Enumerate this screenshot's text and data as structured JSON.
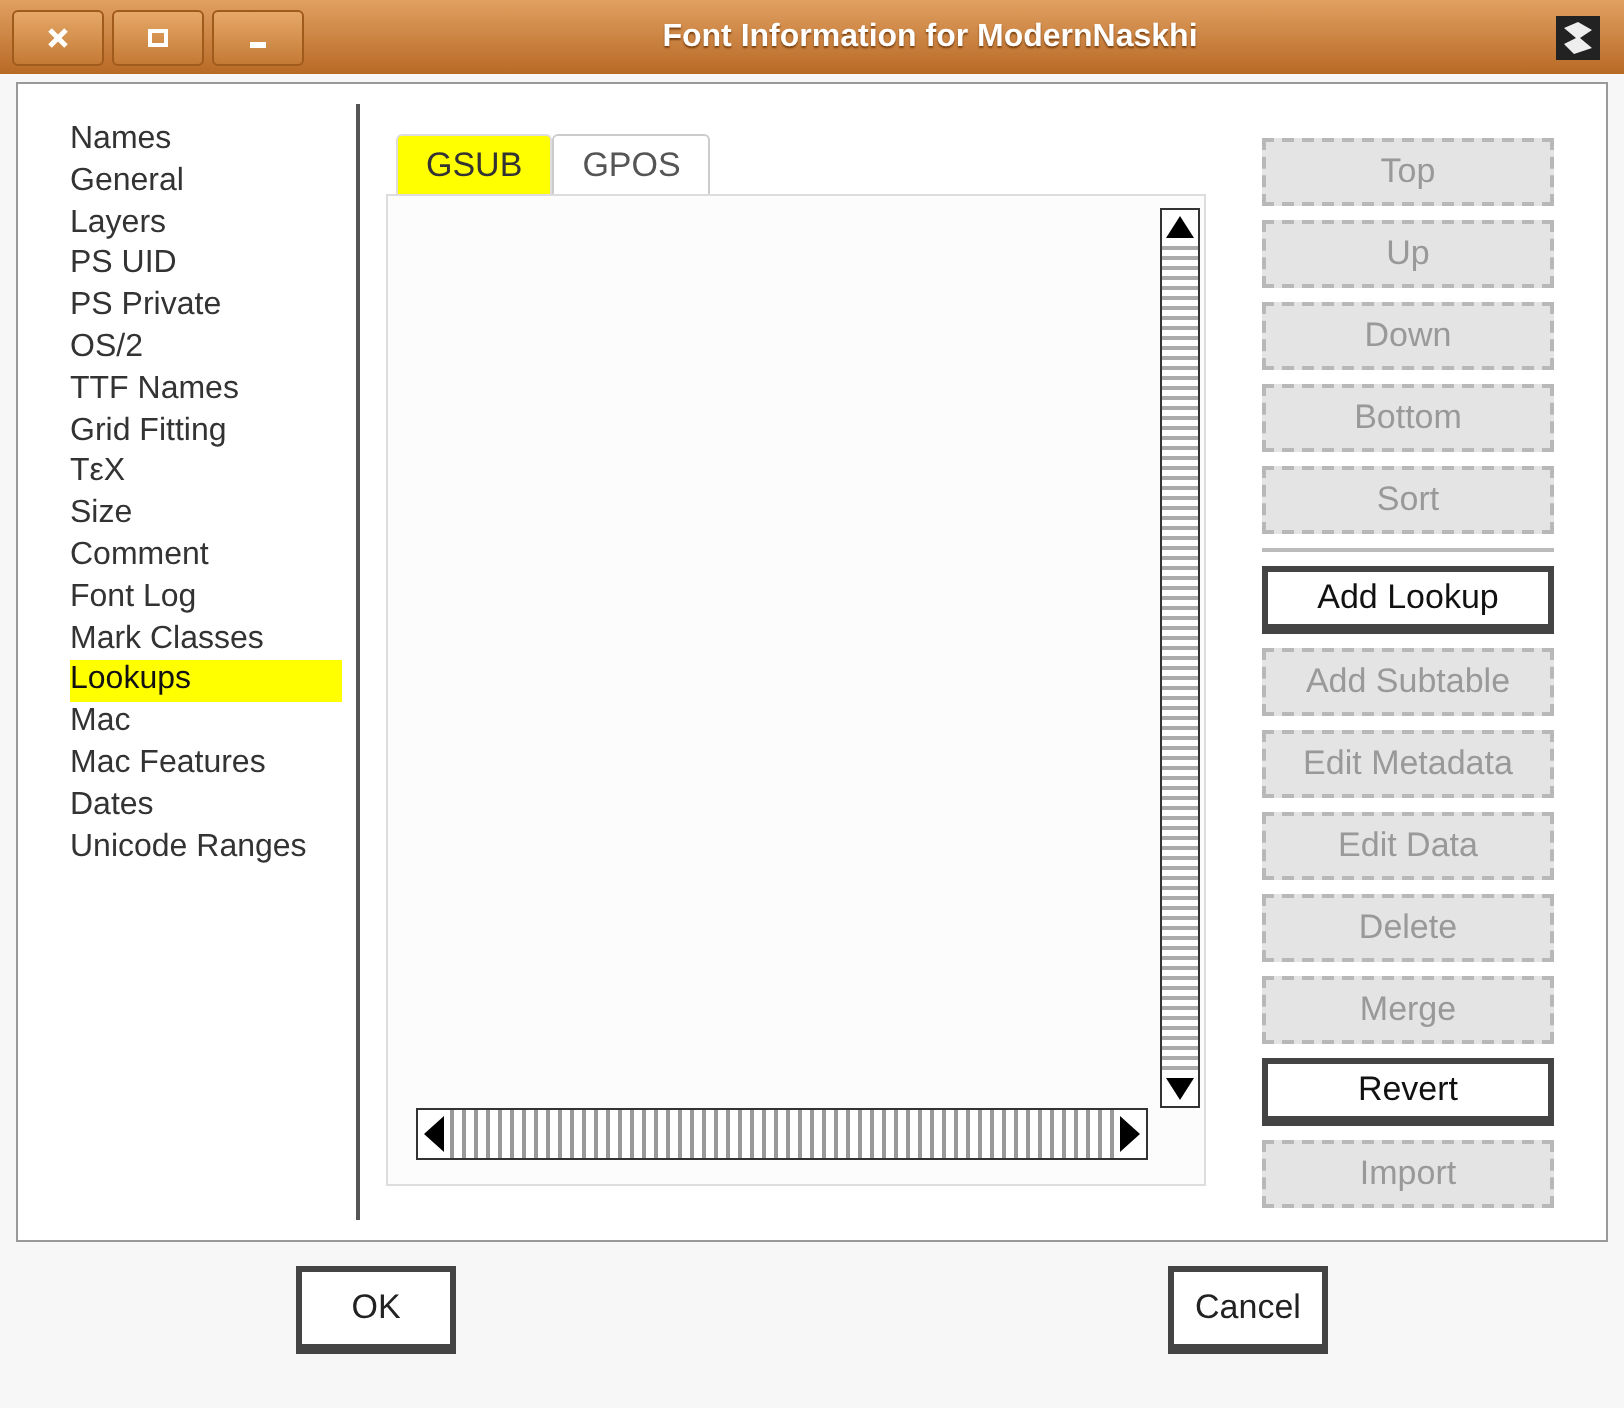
{
  "window": {
    "title": "Font Information for ModernNaskhi"
  },
  "sidebar": {
    "items": [
      {
        "label": "Names",
        "selected": false
      },
      {
        "label": "General",
        "selected": false
      },
      {
        "label": "Layers",
        "selected": false
      },
      {
        "label": "PS UID",
        "selected": false
      },
      {
        "label": "PS Private",
        "selected": false
      },
      {
        "label": "OS/2",
        "selected": false
      },
      {
        "label": "TTF Names",
        "selected": false
      },
      {
        "label": "Grid Fitting",
        "selected": false
      },
      {
        "label": "TεX",
        "selected": false
      },
      {
        "label": "Size",
        "selected": false
      },
      {
        "label": "Comment",
        "selected": false
      },
      {
        "label": "Font Log",
        "selected": false
      },
      {
        "label": "Mark Classes",
        "selected": false
      },
      {
        "label": "Lookups",
        "selected": true
      },
      {
        "label": "Mac",
        "selected": false
      },
      {
        "label": "Mac Features",
        "selected": false
      },
      {
        "label": "Dates",
        "selected": false
      },
      {
        "label": "Unicode Ranges",
        "selected": false
      }
    ]
  },
  "tabs": [
    {
      "label": "GSUB",
      "selected": true
    },
    {
      "label": "GPOS",
      "selected": false
    }
  ],
  "move_buttons": [
    {
      "label": "Top",
      "disabled": true
    },
    {
      "label": "Up",
      "disabled": true
    },
    {
      "label": "Down",
      "disabled": true
    },
    {
      "label": "Bottom",
      "disabled": true
    },
    {
      "label": "Sort",
      "disabled": true
    }
  ],
  "action_buttons": [
    {
      "label": "Add Lookup",
      "disabled": false
    },
    {
      "label": "Add Subtable",
      "disabled": true
    },
    {
      "label": "Edit Metadata",
      "disabled": true
    },
    {
      "label": "Edit Data",
      "disabled": true
    },
    {
      "label": "Delete",
      "disabled": true
    },
    {
      "label": "Merge",
      "disabled": true
    },
    {
      "label": "Revert",
      "disabled": false
    },
    {
      "label": "Import",
      "disabled": true
    }
  ],
  "footer_buttons": [
    {
      "label": "OK"
    },
    {
      "label": "Cancel"
    }
  ]
}
